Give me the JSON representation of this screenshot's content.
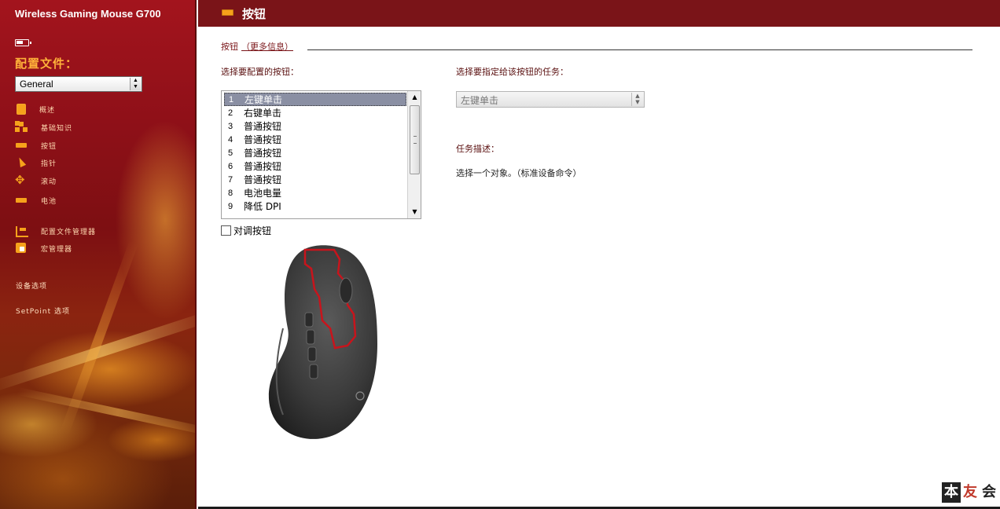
{
  "sidebar": {
    "device_title": "Wireless Gaming Mouse G700",
    "profile_label": "配置文件：",
    "profile_select": "General",
    "nav": [
      {
        "label": "概述",
        "icon": "overview-icon"
      },
      {
        "label": "基础知识",
        "icon": "basics-icon"
      },
      {
        "label": "按钮",
        "icon": "buttons-icon"
      },
      {
        "label": "指针",
        "icon": "pointer-icon"
      },
      {
        "label": "滚动",
        "icon": "scroll-icon"
      },
      {
        "label": "电池",
        "icon": "battery-icon"
      }
    ],
    "tools": [
      {
        "label": "配置文件管理器",
        "icon": "profile-manager-icon"
      },
      {
        "label": "宏管理器",
        "icon": "macro-manager-icon"
      }
    ],
    "device_options": "设备选项",
    "setpoint_options": "SetPoint 选项"
  },
  "header": {
    "title": "按钮"
  },
  "content": {
    "section_title": "按钮",
    "more_info": "（更多信息）",
    "choose_button_label": "选择要配置的按钮：",
    "choose_task_label": "选择要指定给该按钮的任务：",
    "button_list": [
      {
        "num": "1",
        "label": "左键单击",
        "selected": true
      },
      {
        "num": "2",
        "label": "右键单击"
      },
      {
        "num": "3",
        "label": "普通按钮"
      },
      {
        "num": "4",
        "label": "普通按钮"
      },
      {
        "num": "5",
        "label": "普通按钮"
      },
      {
        "num": "6",
        "label": "普通按钮"
      },
      {
        "num": "7",
        "label": "普通按钮"
      },
      {
        "num": "8",
        "label": "电池电量"
      },
      {
        "num": "9",
        "label": "降低 DPI"
      }
    ],
    "swap_buttons_label": "对调按钮",
    "task_select": "左键单击",
    "task_desc_label": "任务描述：",
    "task_desc_text": "选择一个对象。（标准设备命令）"
  },
  "watermark": [
    "本",
    "友",
    "会"
  ],
  "colors": {
    "header_bg": "#7a1418",
    "accent_orange": "#f6a21b",
    "label_red": "#5a1010"
  }
}
